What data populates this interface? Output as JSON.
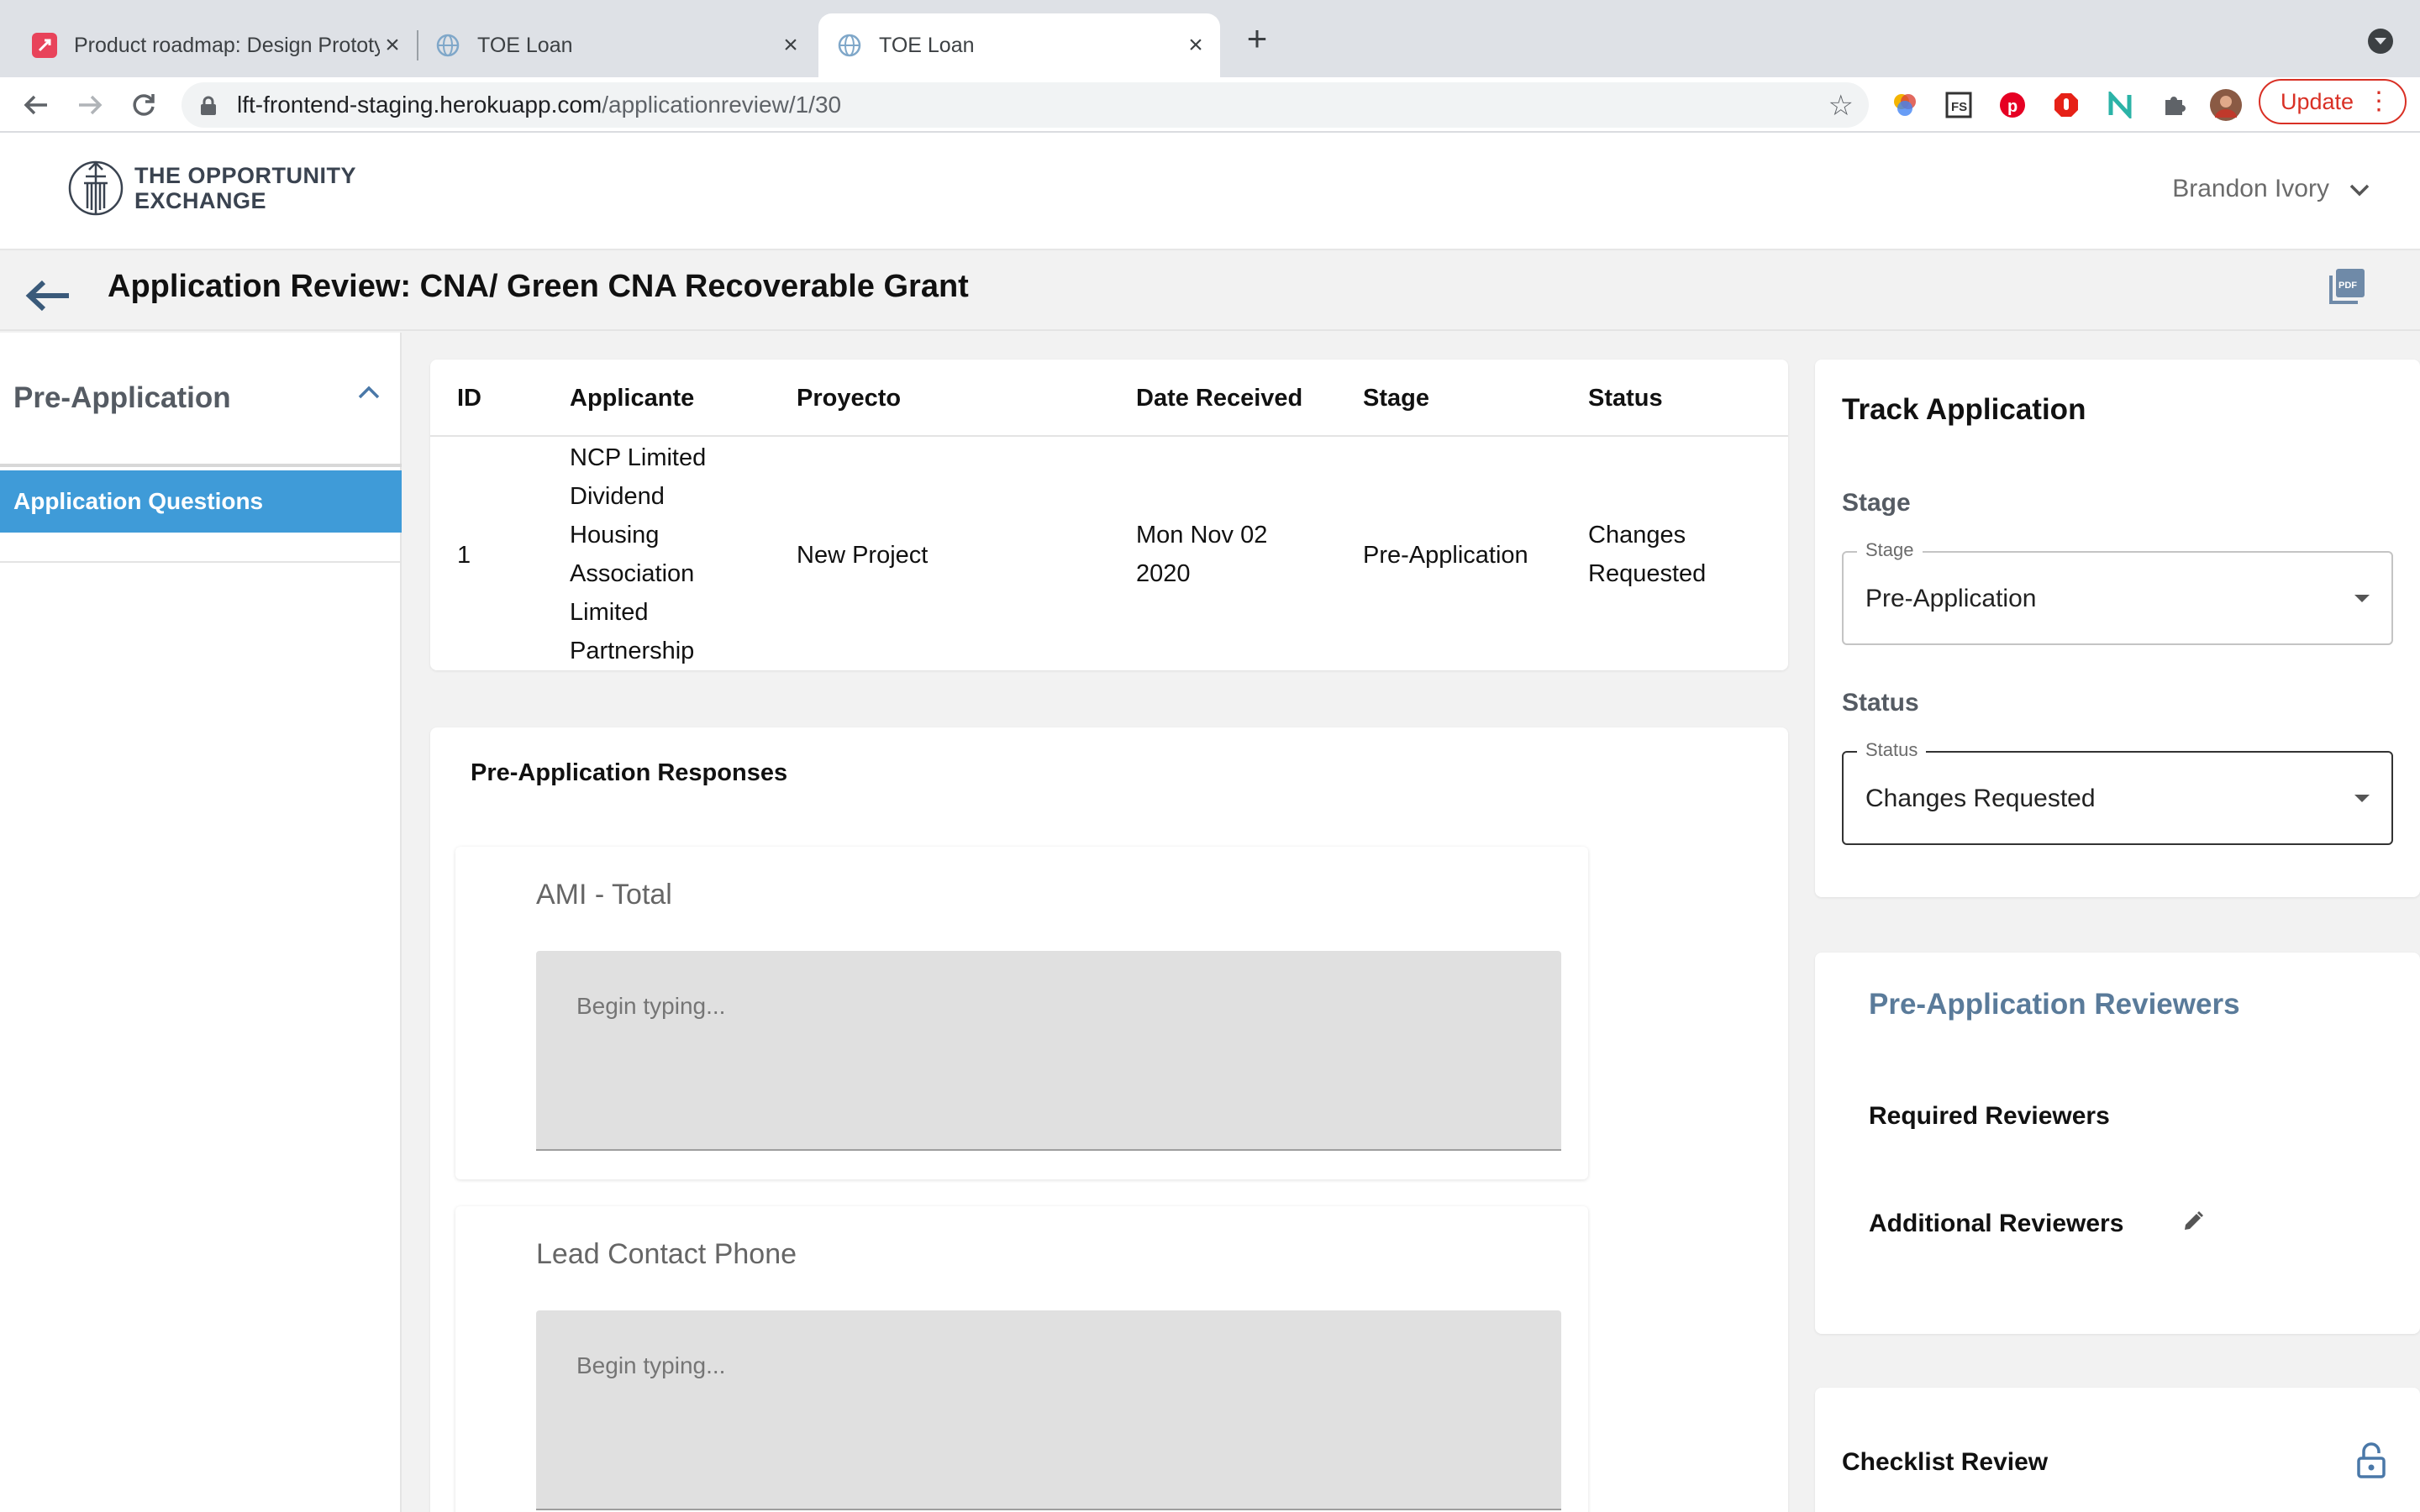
{
  "browser": {
    "tabs": [
      {
        "title": "Product roadmap: Design Prototyping"
      },
      {
        "title": "TOE Loan"
      },
      {
        "title": "TOE Loan"
      }
    ],
    "url_host": "lft-frontend-staging.herokuapp.com",
    "url_path": "/applicationreview/1/30",
    "update_label": "Update"
  },
  "header": {
    "logo_line1": "THE OPPORTUNITY",
    "logo_line2": "EXCHANGE",
    "user_name": "Brandon Ivory"
  },
  "page": {
    "title": "Application Review: CNA/ Green CNA Recoverable Grant"
  },
  "sidebar": {
    "section": "Pre-Application",
    "items": [
      {
        "label": "Application Questions"
      }
    ]
  },
  "table": {
    "columns": [
      "ID",
      "Applicante",
      "Proyecto",
      "Date Received",
      "Stage",
      "Status"
    ],
    "row": {
      "id": "1",
      "applicant_lines": [
        "NCP Limited",
        "Dividend",
        "Housing",
        "Association",
        "Limited",
        "Partnership"
      ],
      "project": "New Project",
      "date_lines": [
        "Mon Nov 02",
        "2020"
      ],
      "stage": "Pre-Application",
      "status_lines": [
        "Changes",
        "Requested"
      ]
    }
  },
  "responses": {
    "title": "Pre-Application Responses",
    "questions": [
      {
        "label": "AMI - Total",
        "placeholder": "Begin typing..."
      },
      {
        "label": "Lead Contact Phone",
        "placeholder": "Begin typing..."
      }
    ]
  },
  "track": {
    "title": "Track Application",
    "stage_heading": "Stage",
    "stage_legend": "Stage",
    "stage_value": "Pre-Application",
    "status_heading": "Status",
    "status_legend": "Status",
    "status_value": "Changes Requested"
  },
  "reviewers": {
    "title": "Pre-Application Reviewers",
    "required": "Required Reviewers",
    "additional": "Additional Reviewers"
  },
  "checklist": {
    "title": "Checklist Review"
  },
  "colors": {
    "accent": "#3f9bd8",
    "reviewer_heading": "#5a7b9a",
    "update_red": "#d93025"
  },
  "icons": [
    "back-arrow-icon",
    "pdf-icon",
    "chevron-up-icon",
    "chevron-down-icon",
    "pencil-icon",
    "lock-icon",
    "star-icon"
  ]
}
